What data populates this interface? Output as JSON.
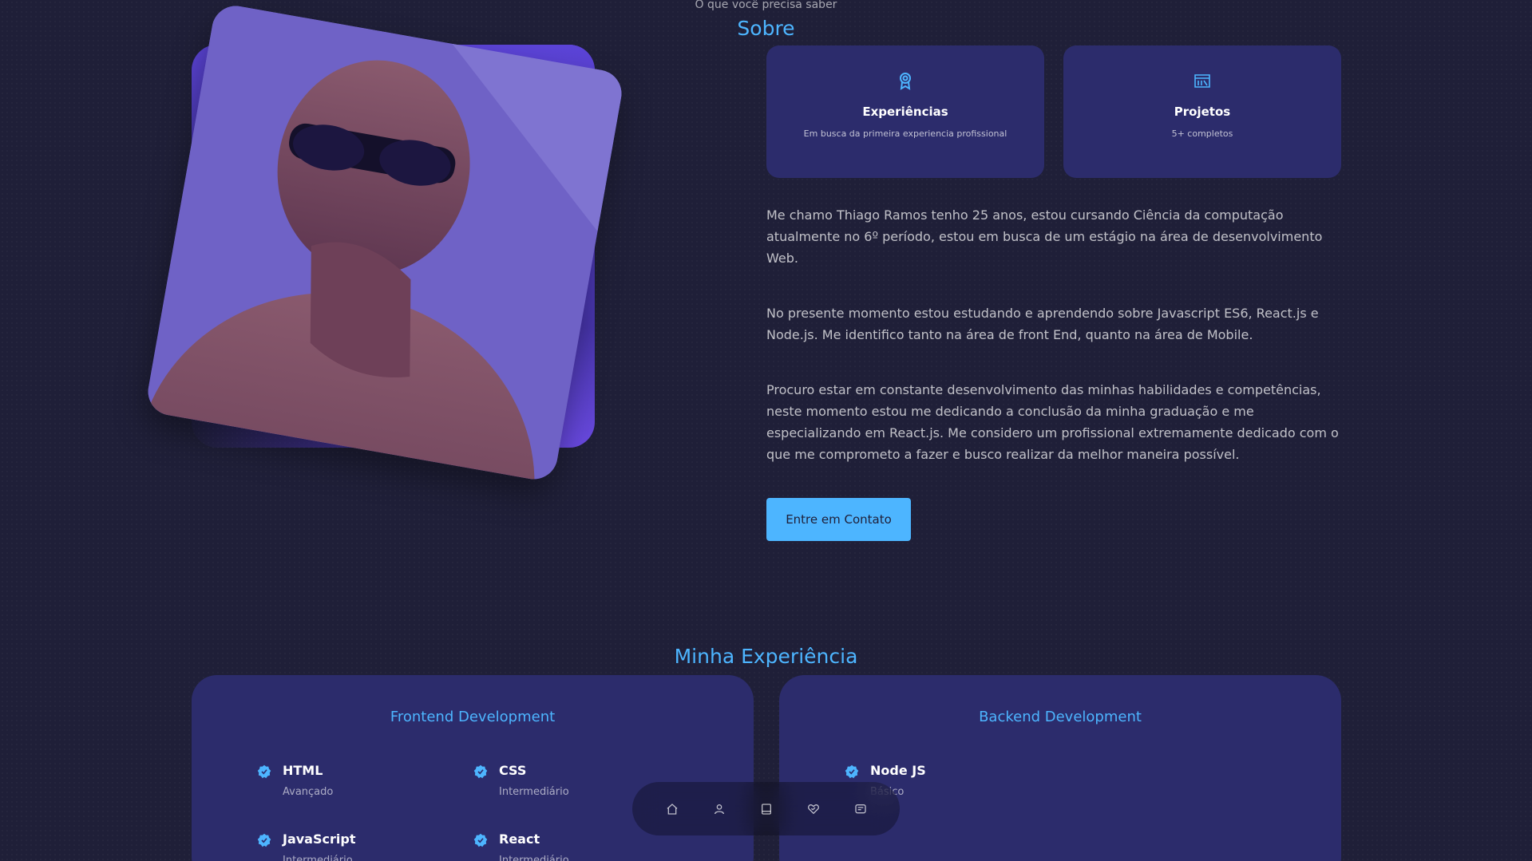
{
  "about": {
    "subtitle": "O que você precisa saber",
    "title": "Sobre",
    "cards": [
      {
        "icon": "award-icon",
        "title": "Experiências",
        "desc": "Em busca da primeira experiencia profissional"
      },
      {
        "icon": "folder-icon",
        "title": "Projetos",
        "desc": "5+ completos"
      }
    ],
    "paragraphs": [
      "Me chamo Thiago Ramos tenho 25 anos, estou cursando Ciência da computação atualmente no 6º período, estou em busca de um estágio na área de desenvolvimento Web.",
      "No presente momento estou estudando e aprendendo sobre Javascript ES6, React.js e Node.js. Me identifico tanto na área de front End, quanto na área de Mobile.",
      "Procuro estar em constante desenvolvimento das minhas habilidades e competências, neste momento estou me dedicando a conclusão da minha graduação e me especializando em React.js. Me considero um profissional extremamente dedicado com o que me comprometo a fazer e busco realizar da melhor maneira possível."
    ],
    "button": "Entre em Contato"
  },
  "experience": {
    "title": "Minha Experiência",
    "frontend": {
      "title": "Frontend Development",
      "skills": [
        {
          "name": "HTML",
          "level": "Avançado"
        },
        {
          "name": "CSS",
          "level": "Intermediário"
        },
        {
          "name": "JavaScript",
          "level": "Intermediário"
        },
        {
          "name": "React",
          "level": "Intermediário"
        }
      ]
    },
    "backend": {
      "title": "Backend Development",
      "skills": [
        {
          "name": "Node JS",
          "level": "Básico"
        }
      ]
    }
  },
  "nav": [
    "home-icon",
    "user-icon",
    "book-icon",
    "heart-icon",
    "message-icon"
  ],
  "colors": {
    "accent": "#4db5ff",
    "card": "#2c2c6c",
    "background": "#1f1f38"
  }
}
